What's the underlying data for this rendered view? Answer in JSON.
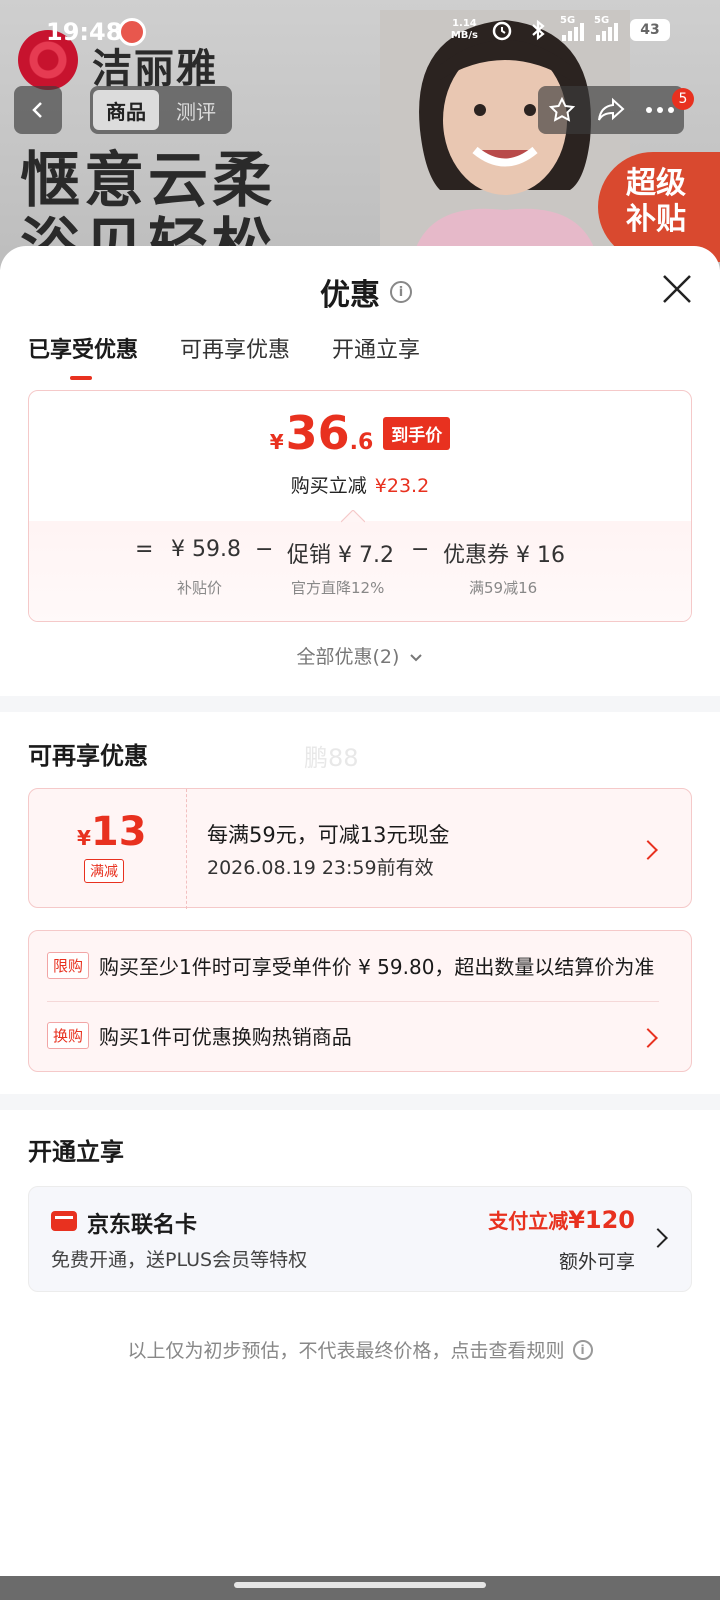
{
  "status_bar": {
    "time": "19:48",
    "net_speed_value": "1.14",
    "net_speed_unit": "MB/s",
    "signal1_label": "5G",
    "signal2_label": "5G",
    "battery": "43"
  },
  "background": {
    "brand_name": "洁丽雅",
    "hero_line1": "惬意云柔",
    "hero_line2": "浴见轻松",
    "subsidy_line1": "超级",
    "subsidy_line2": "补贴",
    "nav_tabs": [
      "商品",
      "测评"
    ],
    "cart_badge": "5"
  },
  "sheet": {
    "title": "优惠",
    "tabs": [
      "已享受优惠",
      "可再享优惠",
      "开通立享"
    ],
    "price": {
      "yen": "¥",
      "integer": "36",
      "decimal": ".6",
      "tag": "到手价",
      "save_label": "购买立减",
      "save_amount": "¥23.2"
    },
    "breakdown": {
      "equals": "=",
      "base": "¥ 59.8",
      "base_label": "补贴价",
      "minus1": "−",
      "promo": "促销 ¥ 7.2",
      "promo_label": "官方直降12%",
      "minus2": "−",
      "coupon": "优惠券 ¥ 16",
      "coupon_label": "满59减16"
    },
    "all_offers": "全部优惠(2)",
    "more_section": {
      "title": "可再享优惠",
      "watermark": "鹏88",
      "coupon": {
        "yen": "¥",
        "amount": "13",
        "type": "满减",
        "desc": "每满59元，可减13元现金",
        "valid": "2026.08.19 23:59前有效"
      },
      "promos": [
        {
          "tag": "限购",
          "text": "购买至少1件时可享受单件价 ¥ 59.80，超出数量以结算价为准"
        },
        {
          "tag": "换购",
          "text": "购买1件可优惠换购热销商品"
        }
      ]
    },
    "open_section": {
      "title": "开通立享",
      "card_name": "京东联名卡",
      "card_sub": "免费开通，送PLUS会员等特权",
      "offer_label": "支付立减",
      "offer_amount": "¥120",
      "extra": "额外可享"
    },
    "disclaimer": "以上仅为初步预估，不代表最终价格，点击查看规则"
  },
  "colors": {
    "accent_red": "#e8311f",
    "card_border": "#f5c9c9",
    "card_bg": "#fff5f5"
  }
}
